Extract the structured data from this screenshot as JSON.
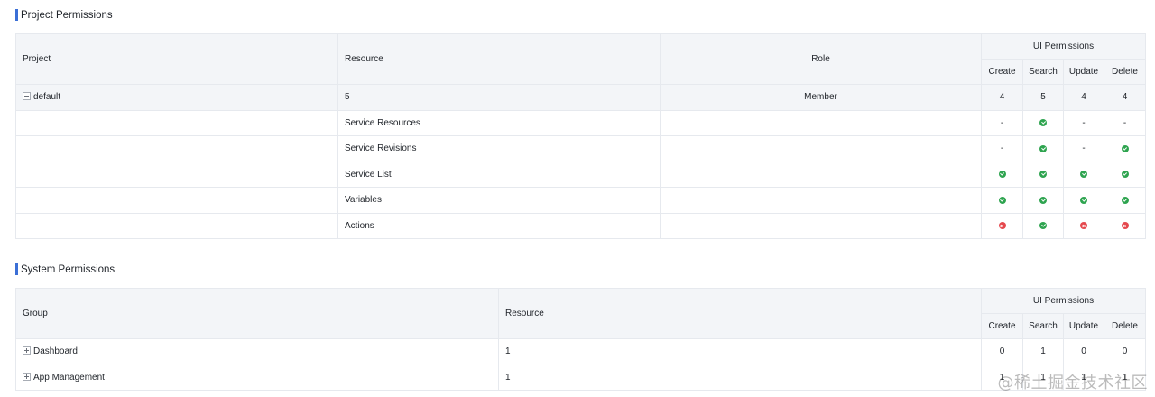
{
  "project_section": {
    "title": "Project Permissions",
    "headers": {
      "project": "Project",
      "resource": "Resource",
      "role": "Role",
      "ui_permissions": "UI Permissions",
      "create": "Create",
      "search": "Search",
      "update": "Update",
      "delete": "Delete"
    },
    "group_row": {
      "project": "default",
      "resource": "5",
      "role": "Member",
      "create": "4",
      "search": "5",
      "update": "4",
      "delete": "4"
    },
    "rows": [
      {
        "resource": "Service Resources",
        "create": "-",
        "search": "ok",
        "update": "-",
        "delete": "-"
      },
      {
        "resource": "Service Revisions",
        "create": "-",
        "search": "ok",
        "update": "-",
        "delete": "ok"
      },
      {
        "resource": "Service List",
        "create": "ok",
        "search": "ok",
        "update": "ok",
        "delete": "ok"
      },
      {
        "resource": "Variables",
        "create": "ok",
        "search": "ok",
        "update": "ok",
        "delete": "ok"
      },
      {
        "resource": "Actions",
        "create": "no",
        "search": "ok",
        "update": "no",
        "delete": "no"
      }
    ]
  },
  "system_section": {
    "title": "System Permissions",
    "headers": {
      "group": "Group",
      "resource": "Resource",
      "ui_permissions": "UI Permissions",
      "create": "Create",
      "search": "Search",
      "update": "Update",
      "delete": "Delete"
    },
    "rows": [
      {
        "group": "Dashboard",
        "resource": "1",
        "create": "0",
        "search": "1",
        "update": "0",
        "delete": "0"
      },
      {
        "group": "App Management",
        "resource": "1",
        "create": "1",
        "search": "1",
        "update": "1",
        "delete": "1"
      }
    ]
  },
  "icons": {
    "ok": "check-circle-icon",
    "no": "x-circle-icon",
    "expand": "expand-icon",
    "collapse": "collapse-icon"
  },
  "colors": {
    "accent": "#3b6fd6",
    "ok": "#2ea44f",
    "no": "#e5484d",
    "header_bg": "#f3f5f8"
  },
  "watermark": "@稀土掘金技术社区"
}
